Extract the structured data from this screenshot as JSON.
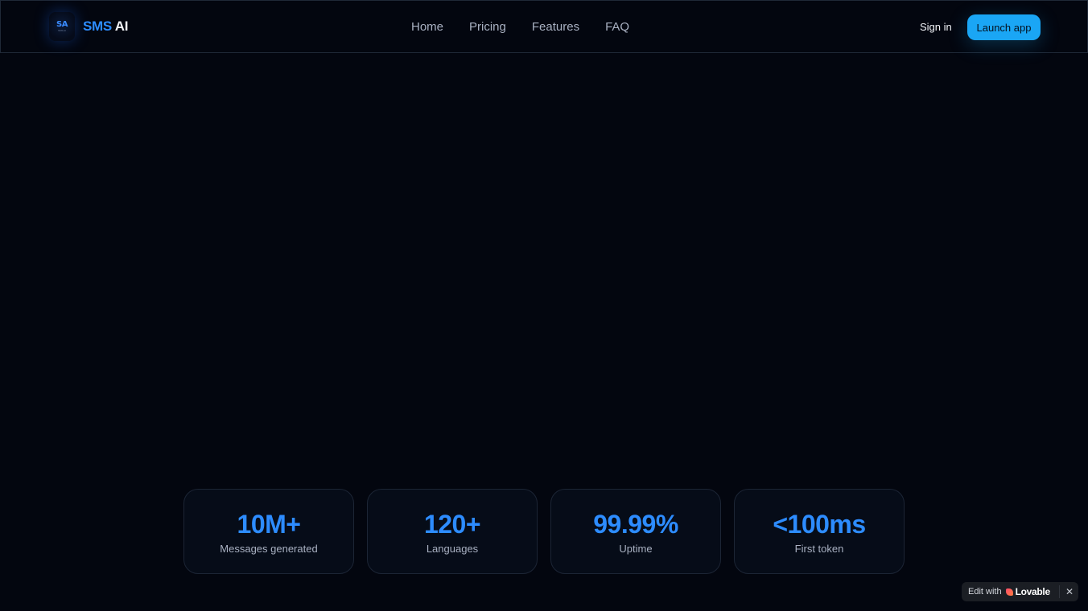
{
  "header": {
    "brand": {
      "logo_mark": "SA",
      "logo_sub": "SMS AI",
      "name_part1": "SMS",
      "name_part2": "AI"
    },
    "nav": [
      {
        "label": "Home"
      },
      {
        "label": "Pricing"
      },
      {
        "label": "Features"
      },
      {
        "label": "FAQ"
      }
    ],
    "sign_in_label": "Sign in",
    "launch_label": "Launch app"
  },
  "stats": [
    {
      "value": "10M+",
      "label": "Messages generated"
    },
    {
      "value": "120+",
      "label": "Languages"
    },
    {
      "value": "99.99%",
      "label": "Uptime"
    },
    {
      "value": "<100ms",
      "label": "First token"
    }
  ],
  "badge": {
    "prefix": "Edit with",
    "brand": "Lovable",
    "close_glyph": "✕"
  },
  "colors": {
    "background": "#03060f",
    "accent_blue": "#2d8cff",
    "launch_button": "#1aa6f5"
  },
  "icons": {
    "logo": "logo-icon",
    "lovable": "heart-icon",
    "close": "close-icon"
  }
}
